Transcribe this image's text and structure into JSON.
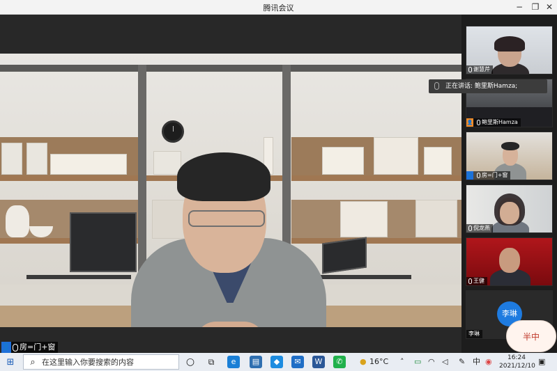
{
  "window": {
    "title": "腾讯会议",
    "min_icon": "minimize-icon",
    "max_icon": "restore-icon",
    "close_icon": "close-icon"
  },
  "main_video": {
    "speaker_name": "房=门+窗"
  },
  "speaking_tip": {
    "text": "正在讲话: 鲍里斯Hamza;"
  },
  "participants": [
    {
      "name": "谢慧芹"
    },
    {
      "name": "鲍里斯Hamza"
    },
    {
      "name": "房=门+窗"
    },
    {
      "name": "倪龙燕"
    },
    {
      "name": "王健"
    },
    {
      "name": "李琳",
      "avatar_text": "李琳"
    }
  ],
  "sticker": {
    "text": "半中"
  },
  "taskbar": {
    "search_placeholder": "在这里输入你要搜索的内容",
    "weather": "16°C",
    "ime": "中",
    "time": "16:24",
    "date": "2021/12/10"
  },
  "colors": {
    "accent": "#1e7be0",
    "taskbar": "#e9edf3"
  }
}
